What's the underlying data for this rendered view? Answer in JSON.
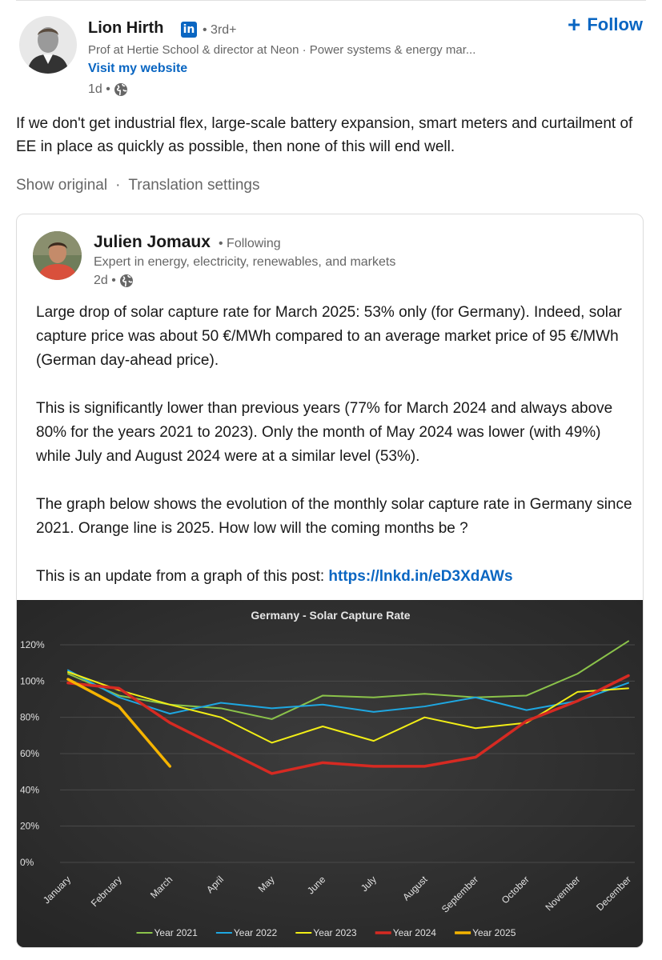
{
  "outer_post": {
    "author": {
      "name": "Lion Hirth",
      "badge": "in",
      "degree": "• 3rd+",
      "headline": "Prof at Hertie School & director at Neon · Power systems & energy mar...",
      "website_label": "Visit my website",
      "time": "1d •"
    },
    "follow_label": "Follow",
    "text": "If we don't get industrial flex, large-scale battery expansion, smart meters and curtailment of EE in place as quickly as possible, then none of this will end well.",
    "translation": {
      "show_original": "Show original",
      "separator": "·",
      "settings": "Translation settings"
    }
  },
  "shared_post": {
    "author": {
      "name": "Julien Jomaux",
      "degree": "• Following",
      "headline": "Expert in energy, electricity, renewables, and markets",
      "time": "2d •"
    },
    "paragraphs": [
      "Large drop of solar capture rate for March 2025: 53% only (for Germany). Indeed, solar capture price was about 50 €/MWh compared to an average market price of 95 €/MWh (German day-ahead price).",
      "This is significantly lower than previous years (77% for March 2024 and always above 80% for the years 2021 to 2023). Only the month of May 2024 was lower (with 49%) while July and August 2024 were at a similar level (53%).",
      "The graph below shows the evolution of the monthly solar capture rate in Germany since 2021. Orange line is 2025. How low will the coming months be ?"
    ],
    "update_prefix": "This is an update from a graph of this post: ",
    "update_link": "https://lnkd.in/eD3XdAWs"
  },
  "chart_data": {
    "type": "line",
    "title": "Germany - Solar Capture Rate",
    "xlabel": "",
    "ylabel": "",
    "categories": [
      "January",
      "February",
      "March",
      "April",
      "May",
      "June",
      "July",
      "August",
      "September",
      "October",
      "November",
      "December"
    ],
    "ylim": [
      0,
      120
    ],
    "yticks": [
      "0%",
      "20%",
      "40%",
      "60%",
      "80%",
      "100%",
      "120%"
    ],
    "yticks_values": [
      0,
      20,
      40,
      60,
      80,
      100,
      120
    ],
    "grid": true,
    "legend_position": "bottom",
    "series": [
      {
        "name": "Year 2021",
        "color": "#8bc34a",
        "values": [
          104,
          92,
          87,
          85,
          79,
          92,
          91,
          93,
          91,
          92,
          104,
          122
        ]
      },
      {
        "name": "Year 2022",
        "color": "#1ea7e1",
        "values": [
          106,
          91,
          82,
          88,
          85,
          87,
          83,
          86,
          91,
          84,
          89,
          99
        ]
      },
      {
        "name": "Year 2023",
        "color": "#f2ee16",
        "values": [
          105,
          95,
          87,
          80,
          66,
          75,
          67,
          80,
          74,
          77,
          94,
          96
        ]
      },
      {
        "name": "Year 2024",
        "color": "#d62a22",
        "values": [
          99,
          96,
          77,
          63,
          49,
          55,
          53,
          53,
          58,
          78,
          89,
          103
        ]
      },
      {
        "name": "Year 2025",
        "color": "#f5b400",
        "values": [
          101,
          86,
          53
        ]
      }
    ]
  }
}
